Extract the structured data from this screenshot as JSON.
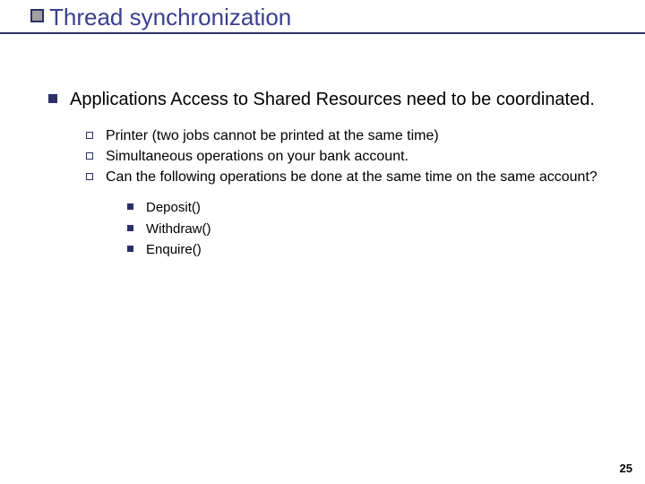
{
  "title": "Thread synchronization",
  "main": {
    "point": "Applications Access to Shared Resources need to be coordinated.",
    "sub": [
      "Printer (two jobs cannot be printed at the same time)",
      "Simultaneous operations on your bank account.",
      "Can the following operations be done at the same time on the same account?"
    ],
    "ops": [
      "Deposit()",
      "Withdraw()",
      "Enquire()"
    ]
  },
  "page_number": "25"
}
